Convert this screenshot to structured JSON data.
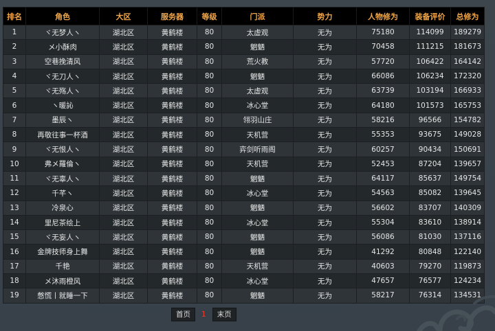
{
  "table": {
    "headers": [
      "排名",
      "角色",
      "大区",
      "服务器",
      "等级",
      "门派",
      "势力",
      "人物修为",
      "装备评价",
      "总修为"
    ],
    "rows": [
      [
        "1",
        "ヾ无梦人ヽ",
        "湖北区",
        "黄鹤楼",
        "80",
        "太虚观",
        "无为",
        "75180",
        "114099",
        "189279"
      ],
      [
        "2",
        "メ小酥肉",
        "湖北区",
        "黄鹤楼",
        "80",
        "魍魉",
        "无为",
        "70458",
        "111215",
        "181673"
      ],
      [
        "3",
        "空巷挽清风",
        "湖北区",
        "黄鹤楼",
        "80",
        "荒火教",
        "无为",
        "57720",
        "106422",
        "164142"
      ],
      [
        "4",
        "ヾ无刀人ヽ",
        "湖北区",
        "黄鹤楼",
        "80",
        "魍魉",
        "无为",
        "66086",
        "106234",
        "172320"
      ],
      [
        "5",
        "ヾ无殇人ヽ",
        "湖北区",
        "黄鹤楼",
        "80",
        "太虚观",
        "无为",
        "63739",
        "103194",
        "166933"
      ],
      [
        "6",
        "ヽ暖訫",
        "湖北区",
        "黄鹤楼",
        "80",
        "冰心堂",
        "无为",
        "64180",
        "101573",
        "165753"
      ],
      [
        "7",
        "墨辰ヽ",
        "湖北区",
        "黄鹤楼",
        "80",
        "翎羽山庄",
        "无为",
        "58216",
        "96566",
        "154782"
      ],
      [
        "8",
        "再敬往事一杯酒",
        "湖北区",
        "黄鹤楼",
        "80",
        "天机营",
        "无为",
        "55353",
        "93675",
        "149028"
      ],
      [
        "9",
        "ヾ无恨人ヽ",
        "湖北区",
        "黄鹤楼",
        "80",
        "弈剑听雨阁",
        "无为",
        "60257",
        "90434",
        "150691"
      ],
      [
        "10",
        "弗メ羅倫ヽ",
        "湖北区",
        "黄鹤楼",
        "80",
        "天机营",
        "无为",
        "52453",
        "87204",
        "139657"
      ],
      [
        "11",
        "ヾ无辜人ヽ",
        "湖北区",
        "黄鹤楼",
        "80",
        "魍魉",
        "无为",
        "64117",
        "85637",
        "149754"
      ],
      [
        "12",
        "千芊ヽ",
        "湖北区",
        "黄鹤楼",
        "80",
        "冰心堂",
        "无为",
        "54563",
        "85082",
        "139645"
      ],
      [
        "13",
        "冷泉心",
        "湖北区",
        "黄鹤楼",
        "80",
        "魍魉",
        "无为",
        "56602",
        "83707",
        "140309"
      ],
      [
        "14",
        "里尼茶绘上",
        "湖北区",
        "黄鹤楼",
        "80",
        "冰心堂",
        "无为",
        "55304",
        "83610",
        "138914"
      ],
      [
        "15",
        "ヾ无妄人ヽ",
        "湖北区",
        "黄鹤楼",
        "80",
        "魍魉",
        "无为",
        "56086",
        "81030",
        "137116"
      ],
      [
        "16",
        "金牌技师身上舞",
        "湖北区",
        "黄鹤楼",
        "80",
        "魍魉",
        "无为",
        "41292",
        "80848",
        "122140"
      ],
      [
        "17",
        "千艳",
        "湖北区",
        "黄鹤楼",
        "80",
        "天机营",
        "无为",
        "40603",
        "79270",
        "119873"
      ],
      [
        "18",
        "メ沐雨橙风",
        "湖北区",
        "黄鹤楼",
        "80",
        "冰心堂",
        "无为",
        "47657",
        "76577",
        "124234"
      ],
      [
        "19",
        "憋慌丨就睡一下",
        "湖北区",
        "黄鹤楼",
        "80",
        "魍魉",
        "无为",
        "58217",
        "76314",
        "134531"
      ]
    ]
  },
  "pagination": {
    "first_label": "首页",
    "current_page": "1",
    "last_label": "末页"
  },
  "colors": {
    "header_bg": "#000000",
    "header_text": "#f0a64a",
    "row_odd": "#2e3438",
    "row_even": "#23282b",
    "current_page": "#f03a2e"
  },
  "icons": {
    "decoration": "cloud-swirl-icon"
  }
}
